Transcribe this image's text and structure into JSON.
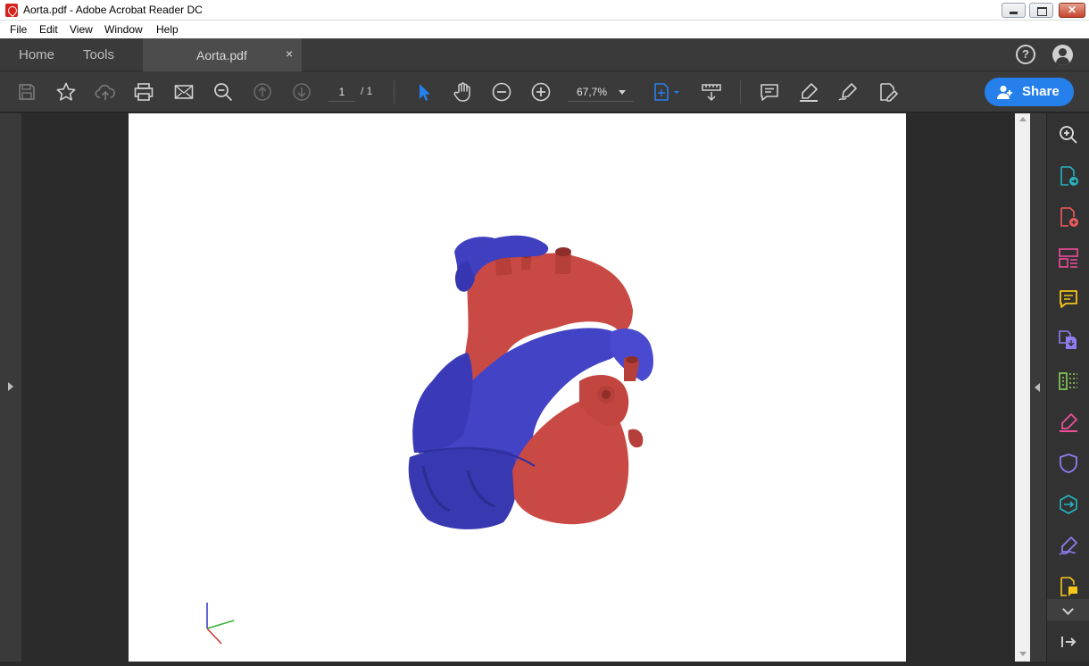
{
  "window": {
    "title": "Aorta.pdf - Adobe Acrobat Reader DC"
  },
  "menu": [
    "File",
    "Edit",
    "View",
    "Window",
    "Help"
  ],
  "tabs": {
    "home": "Home",
    "tools": "Tools",
    "document": "Aorta.pdf",
    "close_symbol": "×"
  },
  "toolbar": {
    "page_current": "1",
    "page_total": "/ 1",
    "zoom": "67,7%",
    "share_label": "Share",
    "accent_color": "#2680eb"
  },
  "help": {
    "symbol": "?"
  },
  "icons": {
    "toolbar": [
      "save-icon",
      "star-icon",
      "cloud-upload-icon",
      "print-icon",
      "mail-icon",
      "search-zoom-icon",
      "page-up-icon",
      "page-down-icon",
      "select-cursor-icon",
      "hand-icon",
      "zoom-out-icon",
      "zoom-in-icon",
      "fit-page-icon",
      "read-mode-icon",
      "comment-icon",
      "highlight-icon",
      "draw-icon",
      "fill-sign-icon"
    ],
    "rightpane": [
      "search-enhance-icon",
      "export-pdf-icon",
      "create-pdf-icon",
      "organize-pages-icon",
      "comment-icon",
      "combine-files-icon",
      "compress-pdf-icon",
      "fill-sign-icon",
      "protect-icon",
      "send-review-icon",
      "request-signature-icon",
      "edit-pdf-icon"
    ]
  },
  "model": {
    "colors": {
      "arterial": "#c94a45",
      "venous": "#3f3fc0"
    }
  }
}
